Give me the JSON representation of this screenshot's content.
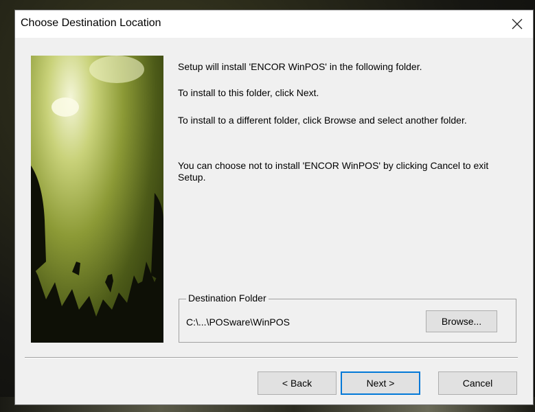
{
  "dialog": {
    "title": "Choose Destination Location",
    "close_glyph": "✕"
  },
  "body": {
    "line1": "Setup will install 'ENCOR WinPOS' in the following folder.",
    "line2": "To install to this folder, click Next.",
    "line3": "To install to a different folder, click Browse and select another folder.",
    "line4": "You can choose not to install 'ENCOR WinPOS' by clicking Cancel to exit Setup."
  },
  "destination": {
    "legend": "Destination Folder",
    "path": "C:\\...\\POSware\\WinPOS",
    "browse_label": "Browse..."
  },
  "buttons": {
    "back_label": "< Back",
    "next_label": "Next >",
    "cancel_label": "Cancel"
  },
  "colors": {
    "dialog_bg": "#f0f0f0",
    "titlebar_bg": "#ffffff",
    "default_button_border": "#0078d7"
  }
}
